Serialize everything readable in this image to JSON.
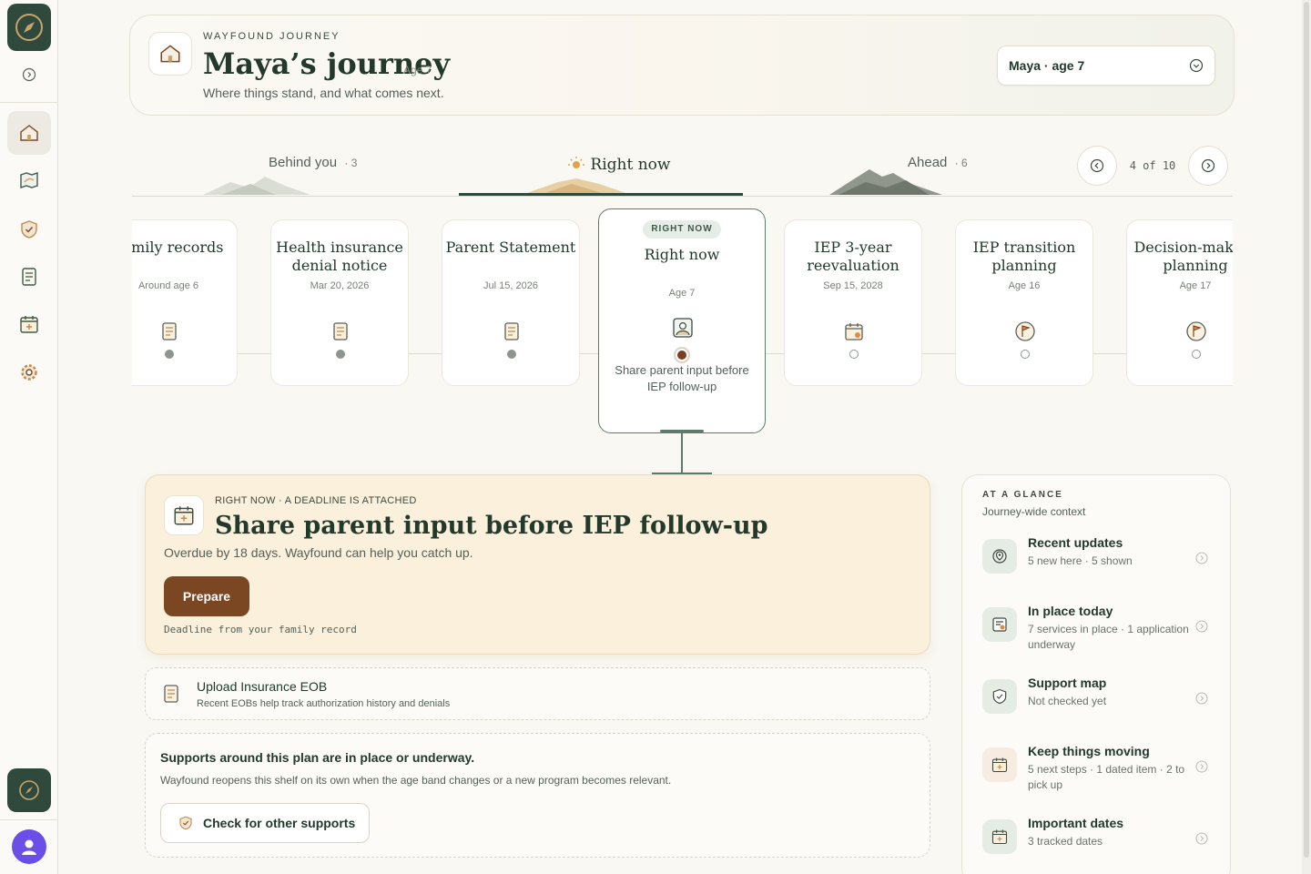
{
  "sidebar": {
    "items": [
      {
        "name": "sidebar-item-home",
        "icon": "home-icon",
        "active": true
      },
      {
        "name": "sidebar-item-map",
        "icon": "map-icon",
        "active": false
      },
      {
        "name": "sidebar-item-supports",
        "icon": "shield-icon",
        "active": false
      },
      {
        "name": "sidebar-item-documents",
        "icon": "document-icon",
        "active": false
      },
      {
        "name": "sidebar-item-calendar",
        "icon": "calendar-icon",
        "active": false
      },
      {
        "name": "sidebar-item-settings",
        "icon": "gear-icon",
        "active": false
      }
    ]
  },
  "header": {
    "eyebrow": "WAYFOUND JOURNEY",
    "title": "Maya’s journey",
    "age": "Age 7",
    "subtitle": "Where things stand, and what comes next.",
    "child_select": "Maya · age 7"
  },
  "tabs": {
    "behind_label": "Behind you",
    "behind_count": "· 3",
    "now_label": "Right now",
    "ahead_label": "Ahead",
    "ahead_count": "· 6",
    "pager": "4 of 10"
  },
  "milestones": [
    {
      "title": "Family records",
      "date": "Around age 6",
      "icon": "document-icon",
      "state": "done"
    },
    {
      "title": "Health insurance denial notice",
      "date": "Mar 20, 2026",
      "icon": "document-icon",
      "state": "done"
    },
    {
      "title": "Parent Statement",
      "date": "Jul 15, 2026",
      "icon": "document-icon",
      "state": "done"
    },
    {
      "title": "IEP 3-year reevaluation",
      "date": "Sep 15, 2028",
      "icon": "calendar-icon",
      "state": "upcoming"
    },
    {
      "title": "IEP transition planning",
      "date": "Age 16",
      "icon": "flag-icon",
      "state": "upcoming"
    },
    {
      "title": "Decision-making planning",
      "date": "Age 17",
      "icon": "flag-icon",
      "state": "upcoming"
    }
  ],
  "now_card": {
    "badge": "RIGHT NOW",
    "title": "Right now",
    "age": "Age 7",
    "text": "Share parent input before IEP follow-up"
  },
  "focus": {
    "eyebrow": "RIGHT NOW · A DEADLINE IS ATTACHED",
    "title": "Share parent input before IEP follow-up",
    "subtitle": "Overdue by 18 days. Wayfound can help you catch up.",
    "button": "Prepare",
    "footnote": "Deadline from your family record"
  },
  "upload": {
    "title": "Upload Insurance EOB",
    "subtitle": "Recent EOBs help track authorization history and denials"
  },
  "supports": {
    "title": "Supports around this plan are in place or underway.",
    "subtitle": "Wayfound reopens this shelf on its own when the age band changes or a new program becomes relevant.",
    "button": "Check for other supports"
  },
  "glance": {
    "eyebrow": "AT A GLANCE",
    "subtitle": "Journey-wide context",
    "items": [
      {
        "title": "Recent updates",
        "sub": "5 new here · 5 shown",
        "icon": "location-pin-icon"
      },
      {
        "title": "In place today",
        "sub": "7 services in place · 1 application underway",
        "icon": "checklist-icon"
      },
      {
        "title": "Support map",
        "sub": "Not checked yet",
        "icon": "shield-icon"
      },
      {
        "title": "Keep things moving",
        "sub": "5 next steps · 1 dated item · 2 to pick up",
        "icon": "calendar-icon"
      },
      {
        "title": "Important dates",
        "sub": "3 tracked dates",
        "icon": "calendar-icon"
      }
    ]
  },
  "colors": {
    "brand": "#2f4a3c",
    "accent": "#7a4722",
    "focus_bg": "#faf0db"
  }
}
